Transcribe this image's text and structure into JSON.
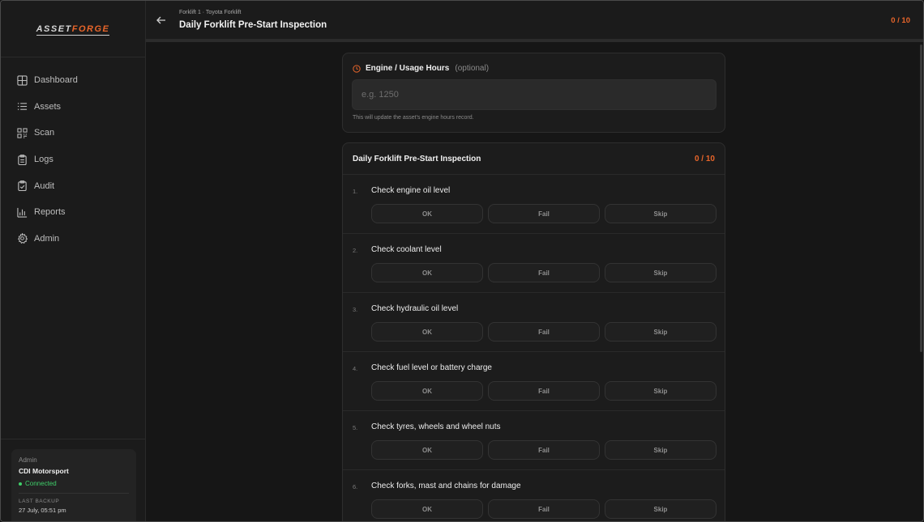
{
  "app": {
    "logo_main": "ASSET",
    "logo_accent": "FORGE",
    "accent_color": "#e8652a",
    "connected_color": "#3fcf6a"
  },
  "sidebar": {
    "items": [
      {
        "label": "Dashboard",
        "icon": "grid-icon"
      },
      {
        "label": "Assets",
        "icon": "list-icon"
      },
      {
        "label": "Scan",
        "icon": "qr-icon"
      },
      {
        "label": "Logs",
        "icon": "clipboard-icon"
      },
      {
        "label": "Audit",
        "icon": "clipboard-check-icon"
      },
      {
        "label": "Reports",
        "icon": "bar-chart-icon"
      },
      {
        "label": "Admin",
        "icon": "gear-icon"
      }
    ],
    "status": {
      "role": "Admin",
      "org": "CDI Motorsport",
      "connection": "Connected",
      "last_backup_label": "LAST BACKUP",
      "last_backup_value": "27 July, 05:51 pm"
    }
  },
  "header": {
    "breadcrumb": "Forklift 1 · Toyota Forklift",
    "title": "Daily Forklift Pre-Start Inspection",
    "progress": "0 / 10"
  },
  "hours": {
    "title": "Engine / Usage Hours",
    "optional": "(optional)",
    "placeholder": "e.g. 1250",
    "help": "This will update the asset's engine hours record."
  },
  "checklist": {
    "title": "Daily Forklift Pre-Start Inspection",
    "count": "0 / 10",
    "ok_label": "OK",
    "fail_label": "Fail",
    "skip_label": "Skip",
    "items": [
      {
        "num": "1.",
        "label": "Check engine oil level"
      },
      {
        "num": "2.",
        "label": "Check coolant level"
      },
      {
        "num": "3.",
        "label": "Check hydraulic oil level"
      },
      {
        "num": "4.",
        "label": "Check fuel level or battery charge"
      },
      {
        "num": "5.",
        "label": "Check tyres, wheels and wheel nuts"
      },
      {
        "num": "6.",
        "label": "Check forks, mast and chains for damage"
      }
    ]
  }
}
